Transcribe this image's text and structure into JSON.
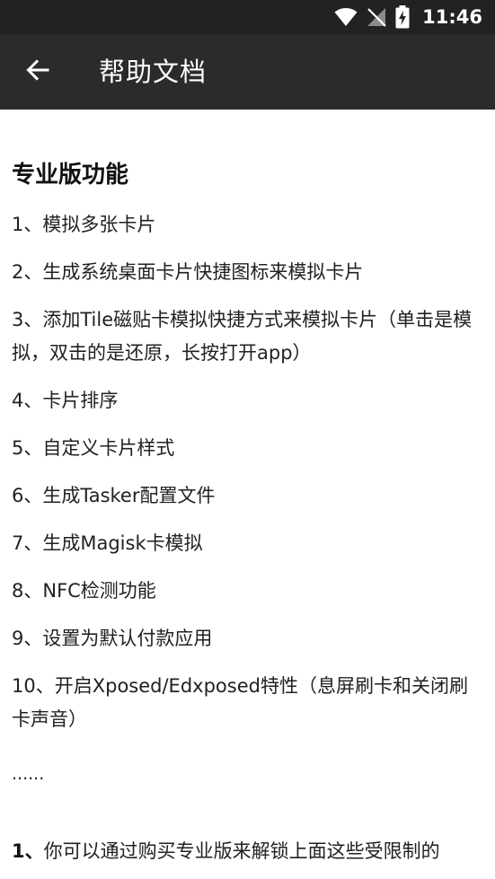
{
  "status_bar": {
    "time": "11:46",
    "icons": [
      "wifi-icon",
      "no-signal-icon",
      "battery-charging-icon"
    ]
  },
  "app_bar": {
    "back_icon": "arrow-left-icon",
    "title": "帮助文档"
  },
  "content": {
    "section_title": "专业版功能",
    "features": [
      "1、模拟多张卡片",
      "2、生成系统桌面卡片快捷图标来模拟卡片",
      "3、添加Tile磁贴卡模拟快捷方式来模拟卡片（单击是模拟，双击的是还原，长按打开app）",
      "4、卡片排序",
      "5、自定义卡片样式",
      "6、生成Tasker配置文件",
      "7、生成Magisk卡模拟",
      "8、NFC检测功能",
      "9、设置为默认付款应用",
      "10、开启Xposed/Edxposed特性（息屏刷卡和关闭刷卡声音）"
    ],
    "ellipsis": "......",
    "note_number": "1、",
    "note_text": "你可以通过购买专业版来解锁上面这些受限制的"
  },
  "colors": {
    "status_bar_bg": "#222222",
    "app_bar_bg": "#2b2b2b",
    "page_bg": "#ffffff",
    "text": "#212121"
  }
}
